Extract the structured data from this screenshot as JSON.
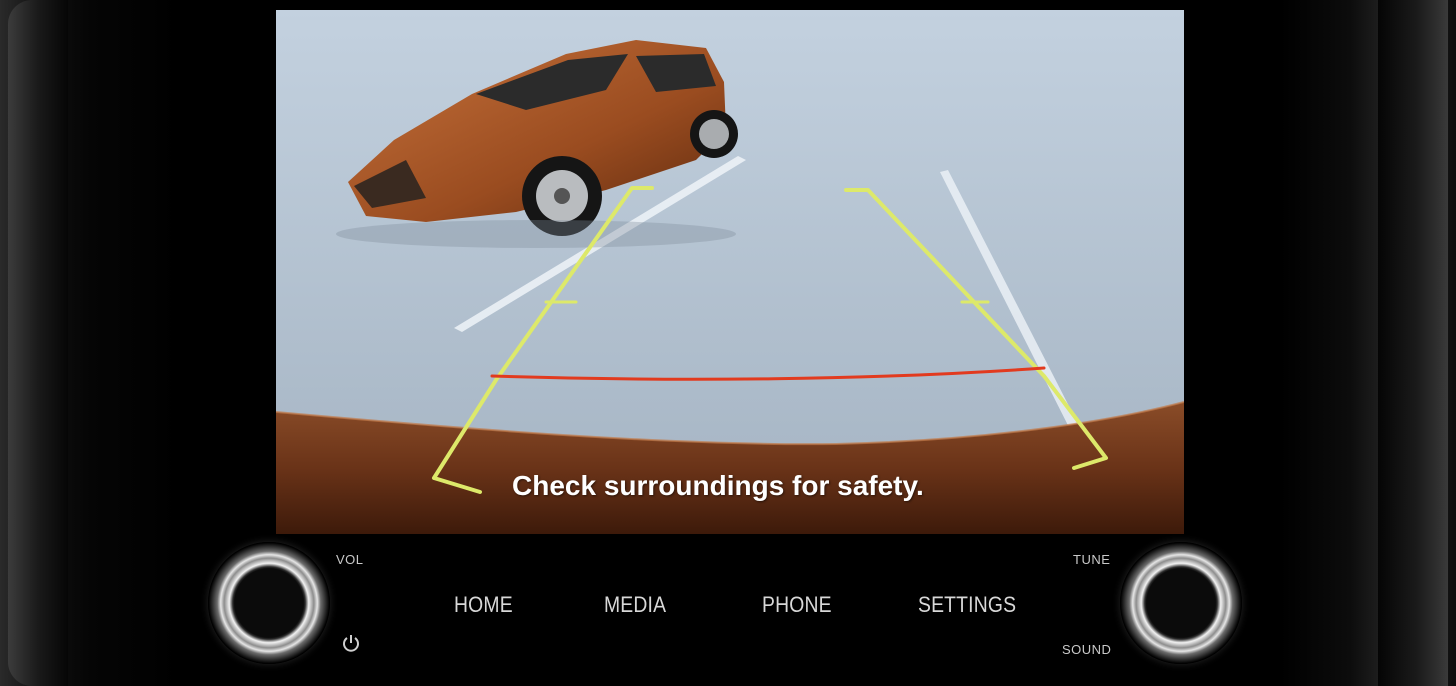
{
  "screen": {
    "warning_text": "Check surroundings for safety.",
    "guide_colors": {
      "near": "#e23a1e",
      "mid": "#d8e84a",
      "far": "#cfe36a",
      "vehicle": "#a8521f"
    }
  },
  "controls": {
    "vol_label": "VOL",
    "tune_label": "TUNE",
    "sound_label": "SOUND",
    "power_icon": "power-icon"
  },
  "nav": {
    "home": "HOME",
    "media": "MEDIA",
    "phone": "PHONE",
    "settings": "SETTINGS"
  }
}
